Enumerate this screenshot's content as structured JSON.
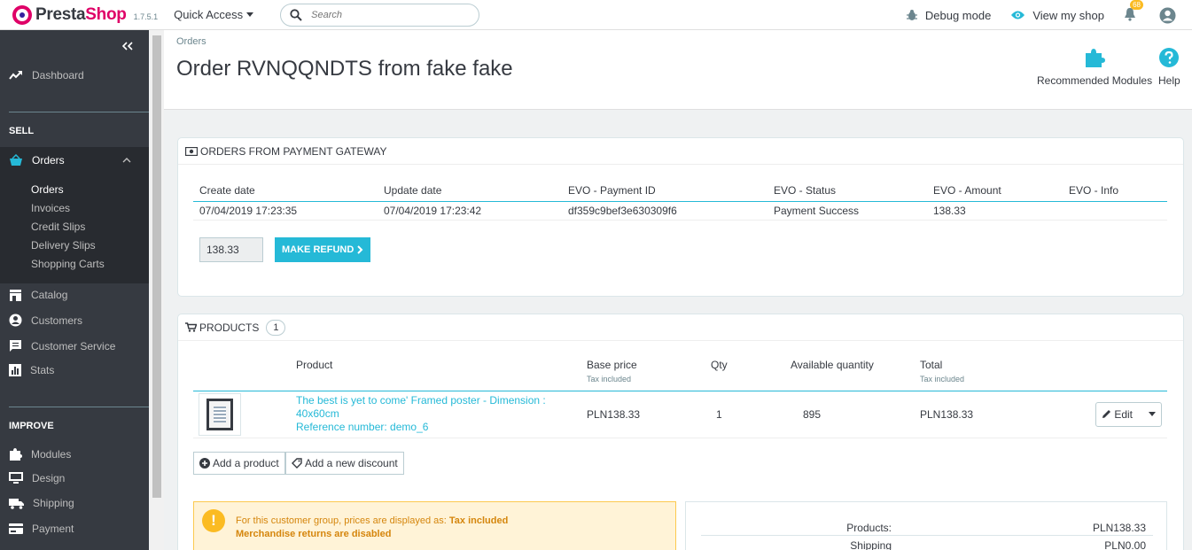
{
  "header": {
    "logo_text": "PrestaShop",
    "version": "1.7.5.1",
    "quick_access": "Quick Access",
    "search_placeholder": "Search",
    "debug_mode": "Debug mode",
    "view_shop": "View my shop",
    "notifications_count": "68"
  },
  "sidebar": {
    "collapse_icon": "double-chevron-left",
    "dashboard": "Dashboard",
    "sell_title": "SELL",
    "orders": "Orders",
    "orders_sub": [
      "Orders",
      "Invoices",
      "Credit Slips",
      "Delivery Slips",
      "Shopping Carts"
    ],
    "catalog": "Catalog",
    "customers": "Customers",
    "customer_service": "Customer Service",
    "stats": "Stats",
    "improve_title": "IMPROVE",
    "modules": "Modules",
    "design": "Design",
    "shipping": "Shipping",
    "payment": "Payment"
  },
  "page": {
    "breadcrumb": "Orders",
    "title": "Order RVNQQNDTS from fake fake",
    "recommended_modules": "Recommended Modules",
    "help": "Help"
  },
  "gateway": {
    "heading": "ORDERS FROM PAYMENT GATEWAY",
    "columns": [
      "Create date",
      "Update date",
      "EVO - Payment ID",
      "EVO - Status",
      "EVO - Amount",
      "EVO - Info"
    ],
    "row": [
      "07/04/2019 17:23:35",
      "07/04/2019 17:23:42",
      "df359c9bef3e630309f6",
      "Payment Success",
      "138.33",
      ""
    ],
    "refund_value": "138.33",
    "refund_button": "MAKE REFUND"
  },
  "products": {
    "heading": "PRODUCTS",
    "count": "1",
    "columns": {
      "product": "Product",
      "base_price": "Base price",
      "base_price_note": "Tax included",
      "qty": "Qty",
      "available": "Available quantity",
      "total": "Total",
      "total_note": "Tax included"
    },
    "row": {
      "name": "The best is yet to come' Framed poster - Dimension : 40x60cm",
      "reference": "Reference number: demo_6",
      "base_price": "PLN138.33",
      "qty": "1",
      "available": "895",
      "total": "PLN138.33",
      "edit": "Edit"
    },
    "add_product": "Add a product",
    "add_discount": "Add a new discount"
  },
  "alert": {
    "line1_prefix": "For this customer group, prices are displayed as: ",
    "line1_value": "Tax included",
    "line2": "Merchandise returns are disabled"
  },
  "totals": {
    "products_label": "Products:",
    "products_value": "PLN138.33",
    "shipping_label": "Shipping",
    "shipping_value": "PLN0.00"
  },
  "colors": {
    "accent": "#25b9d7",
    "sidebar": "#363a41",
    "brand_pink": "#df0067",
    "warning": "#fbbb22"
  }
}
